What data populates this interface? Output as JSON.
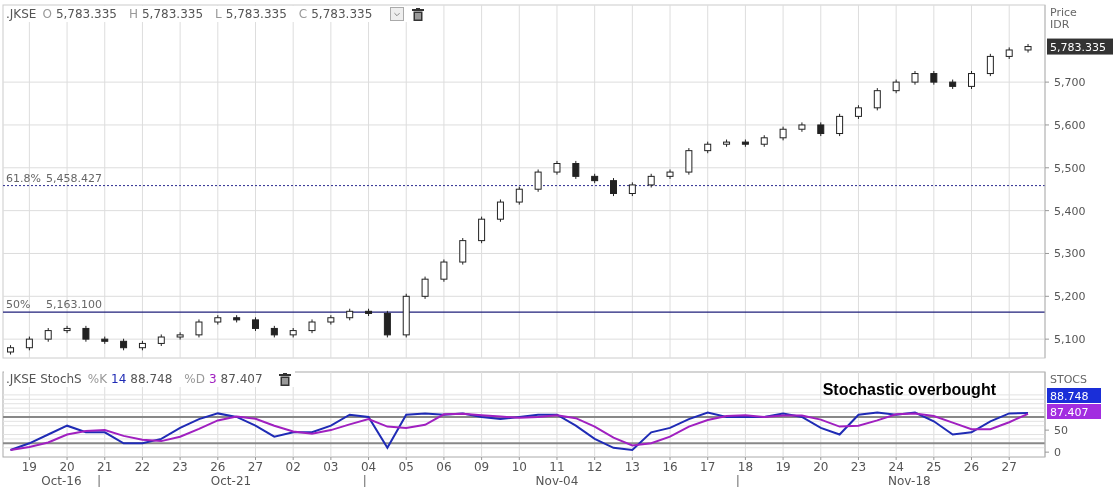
{
  "price_panel": {
    "legend": {
      "symbol": ".JKSE",
      "fields": [
        {
          "label": "O",
          "value": "5,783.335"
        },
        {
          "label": "H",
          "value": "5,783.335"
        },
        {
          "label": "L",
          "value": "5,783.335"
        },
        {
          "label": "C",
          "value": "5,783.335"
        }
      ]
    },
    "axis_title": [
      "Price",
      "IDR"
    ],
    "last_price": "5,783.335",
    "levels": [
      {
        "label": "61.8%"
      },
      {
        "label": "50%"
      }
    ],
    "chart_data": {
      "type": "candlestick",
      "grid": true,
      "ylim": [
        5056,
        5880
      ],
      "yticks": [
        {
          "value": 5100,
          "label": "5,100"
        },
        {
          "value": 5200,
          "label": "5,200"
        },
        {
          "value": 5300,
          "label": "5,300"
        },
        {
          "value": 5400,
          "label": "5,400"
        },
        {
          "value": 5500,
          "label": "5,500"
        },
        {
          "value": 5600,
          "label": "5,600"
        },
        {
          "value": 5700,
          "label": "5,700"
        }
      ],
      "ref_lines": [
        {
          "axis": "y",
          "value": 5458.427,
          "label": "5,458.427",
          "color": "#2b2b8f"
        },
        {
          "axis": "y",
          "value": 5163.1,
          "label": "5,163.100",
          "color": "#1f1f7a"
        }
      ],
      "categories": [
        null,
        null,
        null,
        null,
        null,
        null,
        null,
        null,
        null,
        null,
        null,
        null,
        null,
        null,
        null,
        null,
        null,
        null,
        null,
        null,
        null,
        null,
        null,
        null,
        null,
        null,
        null,
        null,
        null,
        null,
        null,
        null,
        null,
        null,
        null,
        null,
        null,
        null,
        null,
        null,
        null,
        null,
        null,
        null,
        null,
        null,
        null,
        null,
        null,
        null,
        null,
        null,
        null,
        null,
        null
      ],
      "ohlc": [
        [
          5070,
          5086,
          5064,
          5080
        ],
        [
          5080,
          5106,
          5074,
          5100
        ],
        [
          5100,
          5126,
          5094,
          5120
        ],
        [
          5120,
          5131,
          5114,
          5125
        ],
        [
          5125,
          5131,
          5094,
          5100
        ],
        [
          5100,
          5106,
          5089,
          5095
        ],
        [
          5095,
          5101,
          5074,
          5080
        ],
        [
          5080,
          5096,
          5074,
          5090
        ],
        [
          5090,
          5111,
          5084,
          5105
        ],
        [
          5105,
          5116,
          5099,
          5110
        ],
        [
          5110,
          5146,
          5104,
          5140
        ],
        [
          5140,
          5156,
          5134,
          5150
        ],
        [
          5150,
          5156,
          5139,
          5145
        ],
        [
          5145,
          5151,
          5119,
          5125
        ],
        [
          5125,
          5131,
          5104,
          5110
        ],
        [
          5110,
          5126,
          5104,
          5120
        ],
        [
          5120,
          5146,
          5114,
          5140
        ],
        [
          5140,
          5156,
          5134,
          5150
        ],
        [
          5150,
          5171,
          5144,
          5165
        ],
        [
          5165,
          5171,
          5154,
          5160
        ],
        [
          5160,
          5166,
          5104,
          5110
        ],
        [
          5110,
          5206,
          5104,
          5200
        ],
        [
          5200,
          5246,
          5194,
          5240
        ],
        [
          5240,
          5286,
          5234,
          5280
        ],
        [
          5280,
          5336,
          5274,
          5330
        ],
        [
          5330,
          5386,
          5324,
          5380
        ],
        [
          5380,
          5426,
          5374,
          5420
        ],
        [
          5420,
          5456,
          5414,
          5450
        ],
        [
          5450,
          5496,
          5444,
          5490
        ],
        [
          5490,
          5516,
          5484,
          5510
        ],
        [
          5510,
          5516,
          5474,
          5480
        ],
        [
          5480,
          5486,
          5464,
          5470
        ],
        [
          5470,
          5476,
          5434,
          5440
        ],
        [
          5440,
          5466,
          5434,
          5460
        ],
        [
          5460,
          5486,
          5454,
          5480
        ],
        [
          5480,
          5496,
          5474,
          5490
        ],
        [
          5490,
          5546,
          5484,
          5540
        ],
        [
          5540,
          5561,
          5534,
          5555
        ],
        [
          5555,
          5566,
          5549,
          5560
        ],
        [
          5560,
          5566,
          5549,
          5555
        ],
        [
          5555,
          5576,
          5549,
          5570
        ],
        [
          5570,
          5596,
          5564,
          5590
        ],
        [
          5590,
          5606,
          5584,
          5600
        ],
        [
          5600,
          5606,
          5574,
          5580
        ],
        [
          5580,
          5626,
          5574,
          5620
        ],
        [
          5620,
          5646,
          5614,
          5640
        ],
        [
          5640,
          5686,
          5634,
          5680
        ],
        [
          5680,
          5706,
          5674,
          5700
        ],
        [
          5700,
          5726,
          5694,
          5720
        ],
        [
          5720,
          5726,
          5694,
          5700
        ],
        [
          5700,
          5706,
          5684,
          5690
        ],
        [
          5690,
          5726,
          5684,
          5720
        ],
        [
          5720,
          5766,
          5714,
          5760
        ],
        [
          5760,
          5781,
          5754,
          5775
        ],
        [
          5775,
          5789,
          5769,
          5783
        ]
      ]
    }
  },
  "stoch_panel": {
    "legend": {
      "name": ".JKSE StochS",
      "params": [
        {
          "period": "14",
          "value": "88.748"
        },
        {
          "period": "3",
          "value": "87.407"
        }
      ]
    },
    "axis_title": "STOCS",
    "badges": [
      {
        "text": "88.748",
        "color": "#1a2ed8"
      },
      {
        "text": "87.407",
        "color": "#a22de0"
      }
    ],
    "note": "Stochastic overbought",
    "months": [
      {
        "label": "Oct-16"
      },
      {
        "label": "Oct-21"
      },
      {
        "label": "Nov-04"
      },
      {
        "label": "Nov-18"
      }
    ],
    "chart_data": {
      "type": "line",
      "grid": true,
      "ylim": [
        -11,
        182
      ],
      "yticks": [
        0,
        50
      ],
      "ref_lines": [
        {
          "axis": "y",
          "value": 20,
          "color": "#888888"
        },
        {
          "axis": "y",
          "value": 80,
          "color": "#888888"
        }
      ],
      "categories": [
        null,
        "19",
        null,
        "20",
        null,
        "21",
        null,
        "22",
        null,
        "23",
        null,
        "26",
        null,
        "27",
        null,
        "02",
        null,
        "03",
        null,
        "04",
        null,
        "05",
        null,
        "06",
        null,
        "09",
        null,
        "10",
        null,
        "11",
        null,
        "12",
        null,
        "13",
        null,
        "16",
        null,
        "17",
        null,
        "18",
        null,
        "19",
        null,
        "20",
        null,
        "23",
        null,
        "24",
        null,
        "25",
        null,
        "26",
        null,
        "27",
        null
      ],
      "series": [
        {
          "name": "%K",
          "color": "#1f2bb5",
          "values": [
            5,
            20,
            40,
            60,
            45,
            45,
            20,
            20,
            30,
            55,
            75,
            88,
            80,
            60,
            35,
            45,
            45,
            60,
            85,
            80,
            10,
            85,
            88,
            85,
            88,
            80,
            75,
            80,
            85,
            85,
            60,
            30,
            10,
            5,
            45,
            55,
            75,
            90,
            80,
            80,
            80,
            88,
            80,
            55,
            40,
            85,
            90,
            85,
            90,
            70,
            40,
            45,
            70,
            88,
            89
          ]
        },
        {
          "name": "%D",
          "color": "#a020c0",
          "values": [
            5,
            12,
            22,
            40,
            48,
            50,
            37,
            28,
            25,
            35,
            53,
            72,
            81,
            76,
            60,
            47,
            42,
            50,
            63,
            75,
            58,
            55,
            62,
            86,
            87,
            84,
            81,
            78,
            80,
            84,
            77,
            58,
            33,
            15,
            20,
            35,
            58,
            73,
            82,
            84,
            80,
            83,
            83,
            74,
            58,
            60,
            72,
            86,
            88,
            82,
            67,
            52,
            52,
            68,
            87
          ]
        }
      ]
    }
  }
}
